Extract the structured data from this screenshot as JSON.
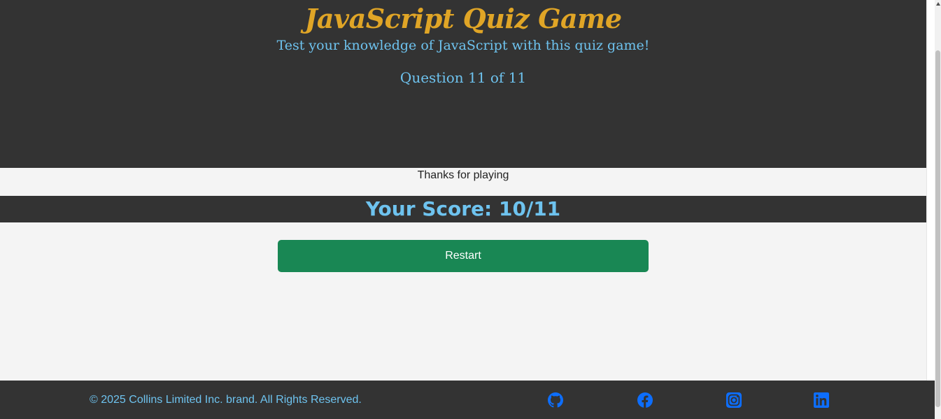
{
  "header": {
    "title": "JavaScript Quiz Game",
    "subtitle": "Test your knowledge of JavaScript with this quiz game!",
    "progress": "Question 11 of 11"
  },
  "result": {
    "thanks": "Thanks for playing",
    "score": "Your Score: 10/11",
    "restart_label": "Restart"
  },
  "footer": {
    "copyright": "© 2025 Collins Limited Inc. brand. All Rights Reserved.",
    "social": [
      {
        "icon": "github-icon"
      },
      {
        "icon": "facebook-icon"
      },
      {
        "icon": "instagram-icon"
      },
      {
        "icon": "linkedin-icon"
      }
    ]
  },
  "colors": {
    "header_bg": "#333333",
    "title": "#e0a526",
    "accent_text": "#6ec3ef",
    "button": "#198754",
    "social_icon": "#0d6efd",
    "page_bg": "#f4f4f4"
  }
}
